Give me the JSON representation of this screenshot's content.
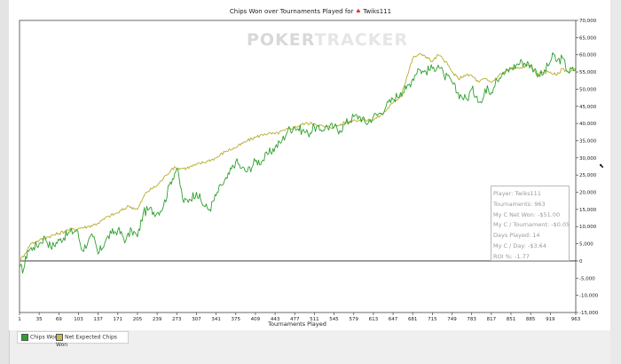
{
  "chart_data": {
    "type": "line",
    "title": "Chips Won over Tournaments Played for",
    "player_name": "Twiks111",
    "xlabel": "Tournaments Played",
    "ylabel": "",
    "xlim": [
      1,
      963
    ],
    "ylim": [
      -15000,
      70000
    ],
    "x_ticks": [
      1,
      35,
      69,
      103,
      137,
      171,
      205,
      239,
      273,
      307,
      341,
      375,
      409,
      443,
      477,
      511,
      545,
      579,
      613,
      647,
      681,
      715,
      749,
      783,
      817,
      851,
      885,
      919,
      963
    ],
    "y_ticks": [
      70000,
      65000,
      60000,
      55000,
      50000,
      45000,
      40000,
      35000,
      30000,
      25000,
      20000,
      15000,
      10000,
      5000,
      0,
      -5000,
      -10000,
      -15000
    ],
    "y_tick_labels": [
      "70,000",
      "65,000",
      "60,000",
      "55,000",
      "50,000",
      "45,000",
      "40,000",
      "35,000",
      "30,000",
      "25,000",
      "20,000",
      "15,000",
      "10,000",
      "5,000",
      "0",
      "-5,000",
      "-10,000",
      "-15,000"
    ],
    "grid": "off",
    "legend_position": "bottom-left",
    "series": [
      {
        "name": "Chips Won",
        "color": "#2ea02e",
        "x": [
          1,
          8,
          15,
          25,
          35,
          45,
          55,
          70,
          85,
          100,
          110,
          120,
          128,
          137,
          150,
          160,
          171,
          185,
          195,
          205,
          215,
          225,
          239,
          250,
          262,
          273,
          285,
          295,
          307,
          320,
          330,
          341,
          350,
          360,
          375,
          385,
          395,
          409,
          420,
          430,
          443,
          455,
          465,
          477,
          490,
          500,
          511,
          520,
          530,
          545,
          555,
          565,
          579,
          590,
          600,
          613,
          625,
          635,
          647,
          660,
          670,
          681,
          690,
          700,
          715,
          725,
          735,
          749,
          758,
          765,
          775,
          783,
          792,
          800,
          810,
          817,
          825,
          835,
          851,
          860,
          870,
          885,
          895,
          905,
          919,
          925,
          930,
          940,
          950,
          963
        ],
        "y": [
          -2000,
          -2500,
          3000,
          4000,
          5000,
          7000,
          4000,
          6000,
          8000,
          9000,
          3000,
          6000,
          7000,
          2000,
          6000,
          8000,
          9000,
          6000,
          9000,
          7000,
          14000,
          15000,
          14000,
          16000,
          23000,
          27000,
          17000,
          18000,
          20000,
          16000,
          15000,
          19000,
          22000,
          24000,
          29000,
          27000,
          26000,
          29000,
          29000,
          31000,
          33000,
          35000,
          38000,
          39000,
          38000,
          37000,
          39000,
          38000,
          39000,
          39000,
          38000,
          40000,
          42000,
          42000,
          40000,
          42000,
          43000,
          45000,
          47000,
          49000,
          50000,
          53000,
          56000,
          55000,
          56000,
          57000,
          54000,
          52000,
          49000,
          48000,
          47000,
          50000,
          48000,
          46000,
          51000,
          49000,
          53000,
          54000,
          56000,
          57000,
          58000,
          57000,
          55000,
          54000,
          58000,
          60000,
          58000,
          59000,
          55000,
          56000
        ]
      },
      {
        "name": "Net Expected Chips Won",
        "color": "#b5ad2e",
        "x": [
          1,
          10,
          20,
          35,
          50,
          69,
          85,
          103,
          120,
          137,
          155,
          171,
          190,
          205,
          220,
          239,
          255,
          265,
          273,
          290,
          307,
          325,
          341,
          358,
          375,
          395,
          409,
          425,
          443,
          460,
          477,
          495,
          511,
          528,
          545,
          560,
          579,
          595,
          613,
          630,
          647,
          660,
          670,
          681,
          690,
          700,
          715,
          725,
          738,
          749,
          760,
          770,
          783,
          795,
          805,
          817,
          830,
          840,
          851,
          865,
          880,
          885,
          895,
          905,
          919,
          930,
          940,
          950,
          963
        ],
        "y": [
          0,
          2000,
          5000,
          6000,
          7000,
          8000,
          9000,
          9500,
          10000,
          11000,
          13000,
          14000,
          16000,
          15000,
          20000,
          22000,
          25000,
          27000,
          27000,
          27000,
          28000,
          29000,
          30000,
          32000,
          33000,
          35000,
          36000,
          37000,
          37000,
          38000,
          39000,
          40000,
          40000,
          39000,
          39000,
          40000,
          41000,
          41000,
          41000,
          43000,
          46000,
          48000,
          53000,
          59000,
          60000,
          60000,
          58000,
          60000,
          58000,
          55000,
          53000,
          54000,
          54000,
          52000,
          53000,
          52000,
          54000,
          55000,
          56000,
          56000,
          57000,
          57000,
          54000,
          55000,
          55000,
          54000,
          56000,
          55000,
          56000
        ]
      }
    ]
  },
  "watermark": {
    "part1": "POKER",
    "part2": "TRACKER"
  },
  "stats": {
    "player": "Player: Twiks111",
    "tournaments": "Tournaments: 963",
    "net_won": "My C Net Won: -$51.00",
    "per_tournament": "My C / Tournament: -$0.05",
    "days_played": "Days Played: 14",
    "per_day": "My C / Day: -$3.64",
    "roi": "ROI %: -1.77"
  },
  "legend": {
    "chips_won": "Chips Won",
    "net_expected": "Net Expected Chips Won",
    "chips_won_color": "#2ea02e",
    "net_expected_color": "#c4bc4a"
  }
}
